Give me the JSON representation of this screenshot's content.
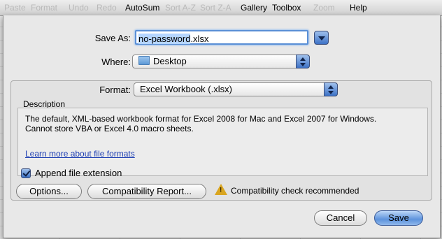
{
  "toolbar": {
    "paste": "Paste",
    "format": "Format",
    "undo": "Undo",
    "redo": "Redo",
    "autosum": "AutoSum",
    "sort_az": "Sort A-Z",
    "sort_za": "Sort Z-A",
    "gallery": "Gallery",
    "toolbox": "Toolbox",
    "zoom": "Zoom",
    "help": "Help"
  },
  "dialog": {
    "save_as_label": "Save As:",
    "filename_selected": "no-password",
    "filename_ext": ".xlsx",
    "where_label": "Where:",
    "where_value": "Desktop",
    "where_icon": "folder-icon",
    "format_label": "Format:",
    "format_value": "Excel Workbook (.xlsx)",
    "description_heading": "Description",
    "description_line1": "The default, XML-based workbook format for Excel 2008 for Mac and Excel 2007 for Windows.",
    "description_line2": "Cannot store VBA or Excel 4.0 macro sheets.",
    "learn_more_link": "Learn more about file formats",
    "append_extension_label": "Append file extension",
    "append_extension_checked": true,
    "options_button": "Options...",
    "compatibility_button": "Compatibility Report...",
    "compat_warning_icon": "warning-icon",
    "compat_warning_text": "Compatibility check recommended",
    "cancel_button": "Cancel",
    "save_button": "Save"
  },
  "colors": {
    "accent_blue": "#3d72c6",
    "link_blue": "#1e3fb3",
    "warning_yellow": "#d9a520"
  }
}
